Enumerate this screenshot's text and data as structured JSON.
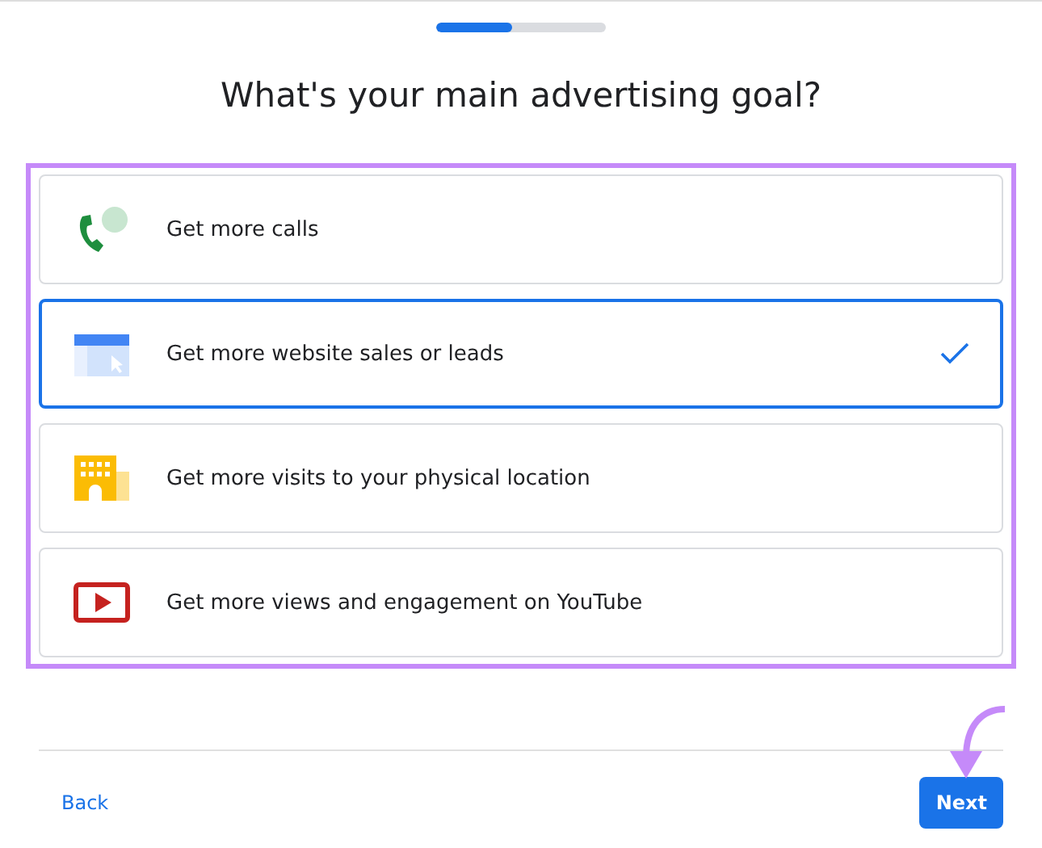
{
  "progress": {
    "level": 0.45
  },
  "title": "What's your main advertising goal?",
  "options": [
    {
      "kind": "phone",
      "label": "Get more calls",
      "selected": false
    },
    {
      "kind": "browser",
      "label": "Get more website sales or leads",
      "selected": true
    },
    {
      "kind": "building",
      "label": "Get more visits to your physical location",
      "selected": false
    },
    {
      "kind": "video",
      "label": "Get more views and engagement on YouTube",
      "selected": false
    }
  ],
  "buttons": {
    "back": "Back",
    "next": "Next"
  }
}
